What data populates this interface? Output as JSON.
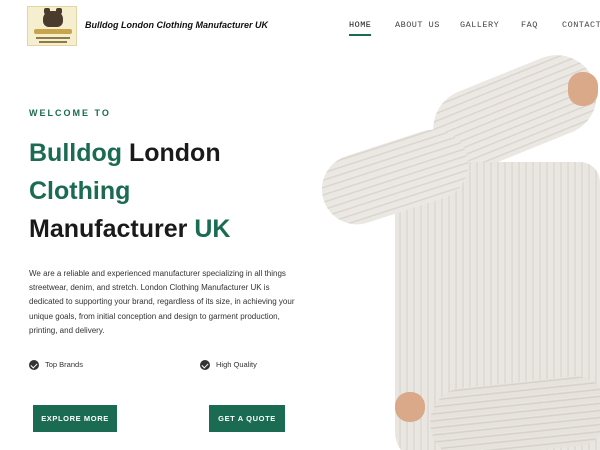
{
  "header": {
    "site_name": "Bulldog London Clothing Manufacturer UK",
    "logo_icon": "bulldog-logo"
  },
  "nav": {
    "items": [
      {
        "label": "HOME",
        "active": true
      },
      {
        "label": "ABOUT US",
        "active": false
      },
      {
        "label": "GALLERY",
        "active": false
      },
      {
        "label": "FAQ",
        "active": false
      },
      {
        "label": "CONTACT",
        "active": false
      }
    ]
  },
  "hero": {
    "eyebrow": "WELCOME TO",
    "title": {
      "line1_green": "Bulldog",
      "line1_dark": " London",
      "line2_green": "Clothing",
      "line3_dark": "Manufacturer ",
      "line3_green": "UK"
    },
    "description": "We are a reliable and experienced manufacturer specializing in all things streetwear, denim, and stretch. London Clothing Manufacturer UK is dedicated to supporting your brand, regardless of its size, in achieving your unique goals, from initial conception and design to garment production, printing, and delivery.",
    "features": [
      {
        "label": "Top Brands",
        "icon": "check-circle-icon"
      },
      {
        "label": "High Quality",
        "icon": "check-circle-icon"
      }
    ],
    "buttons": {
      "explore": "EXPLORE MORE",
      "quote": "GET A QUOTE"
    },
    "image": "person-in-knit-sweater"
  },
  "colors": {
    "accent": "#1b6b52",
    "text": "#1a1a1a",
    "background": "#ffffff"
  }
}
